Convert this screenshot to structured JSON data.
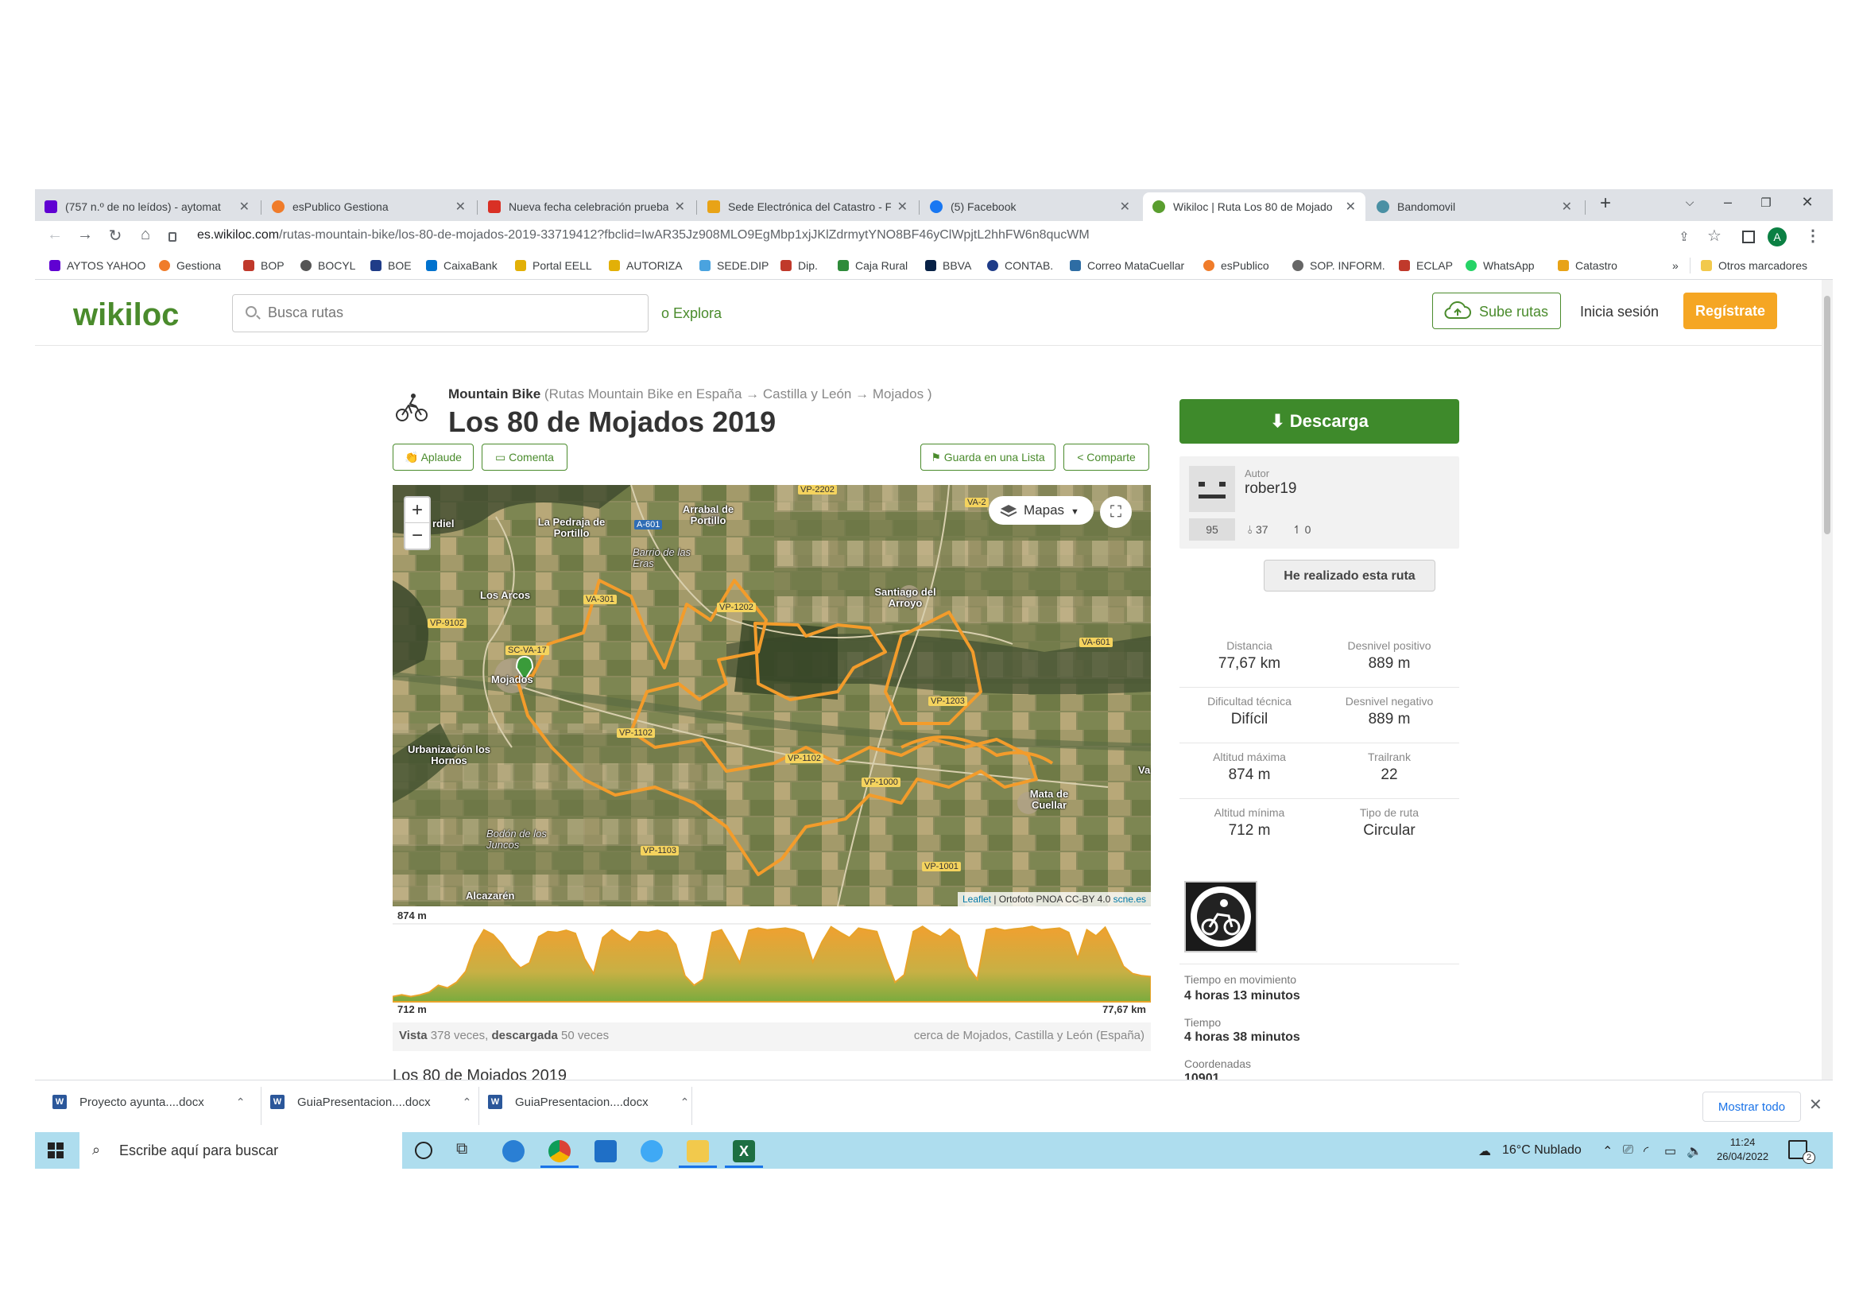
{
  "browser": {
    "tabs": [
      {
        "title": "(757 n.º de no leídos) - aytomat",
        "color": "#6001d2"
      },
      {
        "title": "esPublico Gestiona",
        "color": "#f07c2a"
      },
      {
        "title": "Nueva fecha celebración prueba",
        "color": "#d93025"
      },
      {
        "title": "Sede Electrónica del Catastro - F",
        "color": "#e8a317"
      },
      {
        "title": "(5) Facebook",
        "color": "#1877f2"
      },
      {
        "title": "Wikiloc | Ruta Los 80 de Mojado",
        "color": "#5a9e2f"
      },
      {
        "title": "Bandomovil",
        "color": "#4a90a4"
      }
    ],
    "new_tab": "+",
    "url_domain": "es.wikiloc.com",
    "url_path": "/rutas-mountain-bike/los-80-de-mojados-2019-33719412?fbclid=IwAR35Jz908MLO9EgMbp1xjJKlZdrmytYNO8BF46yClWpjtL2hhFW6n8qucWM",
    "profile_initial": "A",
    "bookmarks": [
      {
        "label": "AYTOS YAHOO",
        "color": "#6001d2"
      },
      {
        "label": "Gestiona",
        "color": "#f07c2a"
      },
      {
        "label": "BOP",
        "color": "#c0392b"
      },
      {
        "label": "BOCYL",
        "color": "#555555"
      },
      {
        "label": "BOE",
        "color": "#1f3c88"
      },
      {
        "label": "CaixaBank",
        "color": "#0072ce"
      },
      {
        "label": "Portal EELL",
        "color": "#e2b007"
      },
      {
        "label": "AUTORIZA",
        "color": "#e2b007"
      },
      {
        "label": "SEDE.DIP",
        "color": "#4aa3df"
      },
      {
        "label": "Dip.",
        "color": "#c0392b"
      },
      {
        "label": "Caja Rural",
        "color": "#2e8b3a"
      },
      {
        "label": "BBVA",
        "color": "#072146"
      },
      {
        "label": "CONTAB.",
        "color": "#1f3c88"
      },
      {
        "label": "Correo MataCuellar",
        "color": "#2e6da4"
      },
      {
        "label": "esPublico",
        "color": "#f07c2a"
      },
      {
        "label": "SOP. INFORM.",
        "color": "#666666"
      },
      {
        "label": "ECLAP",
        "color": "#c0392b"
      },
      {
        "label": "WhatsApp",
        "color": "#25d366"
      },
      {
        "label": "Catastro",
        "color": "#e8a317"
      }
    ],
    "bookmarks_more": "»",
    "other_bookmarks": "Otros marcadores"
  },
  "site": {
    "logo": "wikiloc",
    "search_placeholder": "Busca rutas",
    "explora": "o Explora",
    "upload": "Sube rutas",
    "login": "Inicia sesión",
    "register": "Regístrate"
  },
  "trail": {
    "category": "Mountain Bike",
    "breadcrumb": "(Rutas Mountain Bike en España → Castilla y León → Mojados )",
    "title": "Los 80 de Mojados 2019",
    "actions": {
      "applaud": "Aplaude",
      "comment": "Comenta",
      "save": "Guarda en una Lista",
      "share": "Comparte"
    },
    "map": {
      "layers_button": "Mapas",
      "zoom_in": "+",
      "zoom_out": "−",
      "attribution_leaflet": "Leaflet",
      "attribution_rest": " | Ortofoto PNOA CC-BY 4.0 ",
      "attribution_scne": "scne.es",
      "places": [
        "rdiel",
        "La Pedraja de Portillo",
        "Arrabal de Portillo",
        "Barrio de las Eras",
        "Los Arcos",
        "Santiago del Arroyo",
        "Mojados",
        "Urbanización los Hornos",
        "Mata de Cuellar",
        "Bodón de los Juncos",
        "Alcazarén",
        "Va"
      ],
      "roads": [
        "VP-2202",
        "A-601",
        "VA-301",
        "VP-1202",
        "VP-9102",
        "SC-VA-17",
        "VA-601",
        "VP-1203",
        "VP-1102",
        "VP-1102",
        "VP-1000",
        "VP-1103",
        "VP-1001",
        "VA-2"
      ]
    },
    "elevation": {
      "max_label": "874 m",
      "min_label": "712 m",
      "distance_label": "77,67 km",
      "profile_m": [
        712,
        716,
        712,
        716,
        722,
        738,
        732,
        745,
        770,
        830,
        866,
        855,
        832,
        800,
        778,
        790,
        850,
        862,
        860,
        865,
        858,
        800,
        765,
        848,
        866,
        850,
        838,
        862,
        860,
        865,
        858,
        832,
        760,
        738,
        752,
        860,
        866,
        830,
        790,
        865,
        870,
        866,
        868,
        870,
        866,
        858,
        792,
        838,
        873,
        860,
        848,
        870,
        866,
        862,
        800,
        745,
        762,
        862,
        874,
        860,
        850,
        868,
        852,
        780,
        752,
        866,
        870,
        865,
        868,
        870,
        874,
        866,
        868,
        870,
        860,
        800,
        866,
        852,
        872,
        830,
        782,
        765,
        760,
        758
      ]
    },
    "views_prefix": "Vista",
    "views_count": "378 veces,",
    "downloads_label": "descargada",
    "downloads_count": "50 veces",
    "near": "cerca de Mojados, Castilla y León (España)",
    "description": "Los 80 de Mojados 2019"
  },
  "sidebar": {
    "download": "Descarga",
    "author_label": "Autor",
    "author_name": "rober19",
    "author_rank": "95",
    "author_trails": "37",
    "author_followers": "0",
    "done_button": "He realizado esta ruta",
    "stats": [
      {
        "k": "Distancia",
        "v": "77,67 km"
      },
      {
        "k": "Desnivel positivo",
        "v": "889 m"
      },
      {
        "k": "Dificultad técnica",
        "v": "Difícil"
      },
      {
        "k": "Desnivel negativo",
        "v": "889 m"
      },
      {
        "k": "Altitud máxima",
        "v": "874 m"
      },
      {
        "k": "Trailrank",
        "v": "22"
      },
      {
        "k": "Altitud mínima",
        "v": "712 m"
      },
      {
        "k": "Tipo de ruta",
        "v": "Circular"
      }
    ],
    "info": [
      {
        "k": "Tiempo en movimiento",
        "v": "4 horas 13 minutos"
      },
      {
        "k": "Tiempo",
        "v": "4 horas 38 minutos"
      },
      {
        "k": "Coordenadas",
        "v": "10901"
      }
    ]
  },
  "downloads_bar": {
    "items": [
      "Proyecto ayunta....docx",
      "GuiaPresentacion....docx",
      "GuiaPresentacion....docx"
    ],
    "show_all": "Mostrar todo",
    "close": "✕"
  },
  "taskbar": {
    "search_placeholder": "Escribe aquí para buscar",
    "weather": "16°C  Nublado",
    "time": "11:24",
    "date": "26/04/2022",
    "notifications": "2"
  },
  "colors": {
    "brand_green": "#4a8b2c",
    "download_green": "#3e8a2b",
    "register_orange": "#f5a623",
    "track_orange": "#f39c2b",
    "taskbar": "#aeddee"
  }
}
